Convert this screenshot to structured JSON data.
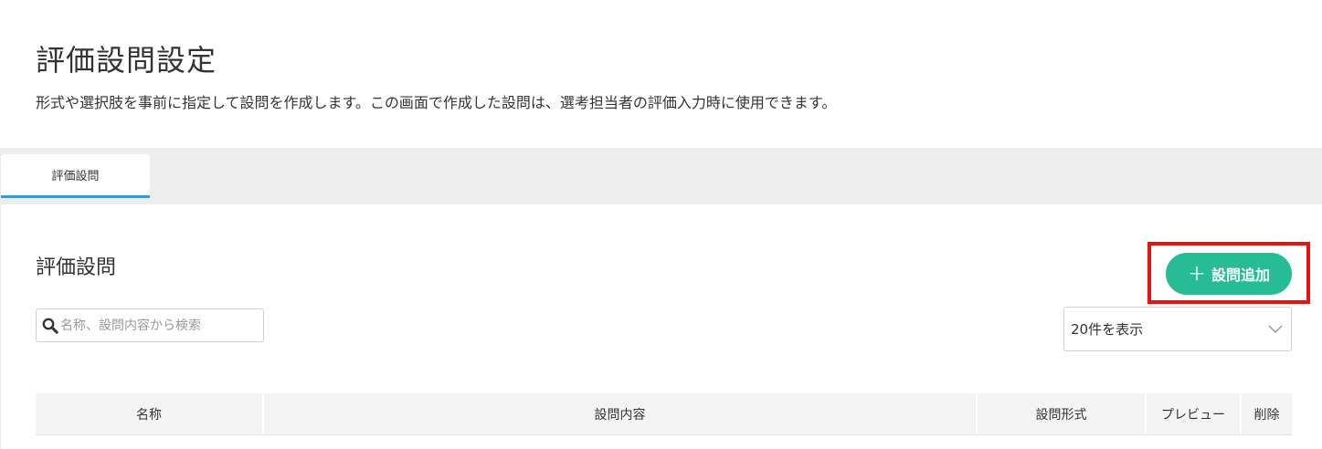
{
  "header": {
    "title": "評価設問設定",
    "description": "形式や選択肢を事前に指定して設問を作成します。この画面で作成した設問は、選考担当者の評価入力時に使用できます。"
  },
  "tabs": [
    {
      "label": "評価設問",
      "active": true
    }
  ],
  "section": {
    "title": "評価設問",
    "add_button": {
      "icon": "plus-icon",
      "label": "設問追加"
    }
  },
  "search": {
    "icon": "search-icon",
    "placeholder": "名称、設問内容から検索",
    "value": ""
  },
  "page_size_select": {
    "selected": "20件を表示",
    "icon": "chevron-down-icon"
  },
  "table": {
    "columns": [
      "名称",
      "設問内容",
      "設問形式",
      "プレビュー",
      "削除"
    ]
  },
  "colors": {
    "accent": "#26bc96",
    "tab_underline": "#3b97d8",
    "highlight": "#ea1010"
  }
}
